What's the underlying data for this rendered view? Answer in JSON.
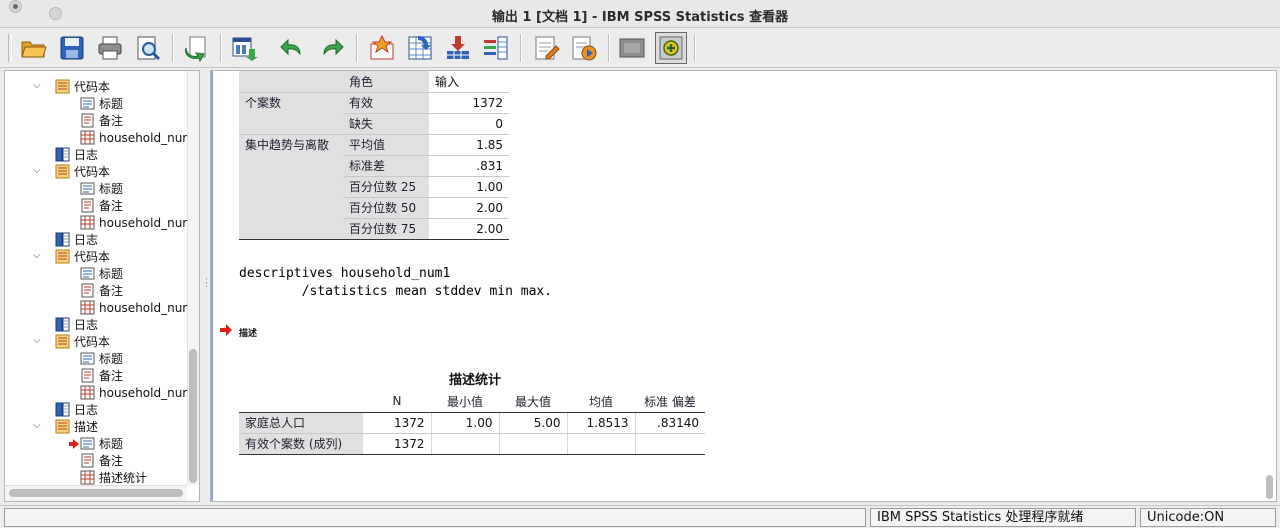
{
  "window": {
    "title": "输出 1 [文档 1] - IBM SPSS Statistics 查看器"
  },
  "toolbar": {
    "buttons": [
      "open-icon",
      "save-icon",
      "print-icon",
      "print-preview-icon",
      "export-icon",
      "recall-dialog-icon",
      "undo-icon",
      "redo-icon",
      "goto-case-icon",
      "goto-variable-icon",
      "insert-cases-icon",
      "variables-icon",
      "syntax-icon",
      "run-script-icon",
      "designate-window-icon",
      "add-output-icon"
    ]
  },
  "tree": {
    "nodes": [
      {
        "label": "代码本",
        "icon": "codebook-icon",
        "level": 1
      },
      {
        "label": "标题",
        "icon": "title-icon",
        "level": 2
      },
      {
        "label": "备注",
        "icon": "notes-icon",
        "level": 2
      },
      {
        "label": "household_nur",
        "icon": "table-icon",
        "level": 2
      },
      {
        "label": "日志",
        "icon": "log-icon",
        "level": 1
      },
      {
        "label": "代码本",
        "icon": "codebook-icon",
        "level": 1
      },
      {
        "label": "标题",
        "icon": "title-icon",
        "level": 2
      },
      {
        "label": "备注",
        "icon": "notes-icon",
        "level": 2
      },
      {
        "label": "household_nur",
        "icon": "table-icon",
        "level": 2
      },
      {
        "label": "日志",
        "icon": "log-icon",
        "level": 1
      },
      {
        "label": "代码本",
        "icon": "codebook-icon",
        "level": 1
      },
      {
        "label": "标题",
        "icon": "title-icon",
        "level": 2
      },
      {
        "label": "备注",
        "icon": "notes-icon",
        "level": 2
      },
      {
        "label": "household_nur",
        "icon": "table-icon",
        "level": 2
      },
      {
        "label": "日志",
        "icon": "log-icon",
        "level": 1
      },
      {
        "label": "代码本",
        "icon": "codebook-icon",
        "level": 1
      },
      {
        "label": "标题",
        "icon": "title-icon",
        "level": 2
      },
      {
        "label": "备注",
        "icon": "notes-icon",
        "level": 2
      },
      {
        "label": "household_nur",
        "icon": "table-icon",
        "level": 2
      },
      {
        "label": "日志",
        "icon": "log-icon",
        "level": 1
      },
      {
        "label": "描述",
        "icon": "codebook-icon",
        "level": 1
      },
      {
        "label": "标题",
        "icon": "title-icon",
        "level": 2,
        "current": true
      },
      {
        "label": "备注",
        "icon": "notes-icon",
        "level": 2
      },
      {
        "label": "描述统计",
        "icon": "table-icon",
        "level": 2
      }
    ]
  },
  "codebook_table": {
    "header": {
      "sub": "角色",
      "value": "输入"
    },
    "groups": [
      {
        "label": "个案数",
        "rows": [
          {
            "sub": "有效",
            "value": "1372"
          },
          {
            "sub": "缺失",
            "value": "0"
          }
        ]
      },
      {
        "label": "集中趋势与离散",
        "rows": [
          {
            "sub": "平均值",
            "value": "1.85"
          },
          {
            "sub": "标准差",
            "value": ".831"
          },
          {
            "sub": "百分位数 25",
            "value": "1.00"
          },
          {
            "sub": "百分位数 50",
            "value": "2.00"
          },
          {
            "sub": "百分位数 75",
            "value": "2.00"
          }
        ]
      }
    ]
  },
  "syntax": {
    "line1": "descriptives household_num1",
    "line2": "        /statistics mean stddev min max."
  },
  "section_heading": "描述",
  "descriptives": {
    "title": "描述统计",
    "columns": [
      "N",
      "最小值",
      "最大值",
      "均值",
      "标准 偏差"
    ],
    "rows": [
      {
        "label": "家庭总人口",
        "cells": [
          "1372",
          "1.00",
          "5.00",
          "1.8513",
          ".83140"
        ]
      },
      {
        "label": "有效个案数 (成列)",
        "cells": [
          "1372",
          "",
          "",
          "",
          ""
        ]
      }
    ]
  },
  "status": {
    "processor": "IBM SPSS Statistics 处理程序就绪",
    "unicode": "Unicode:ON"
  }
}
